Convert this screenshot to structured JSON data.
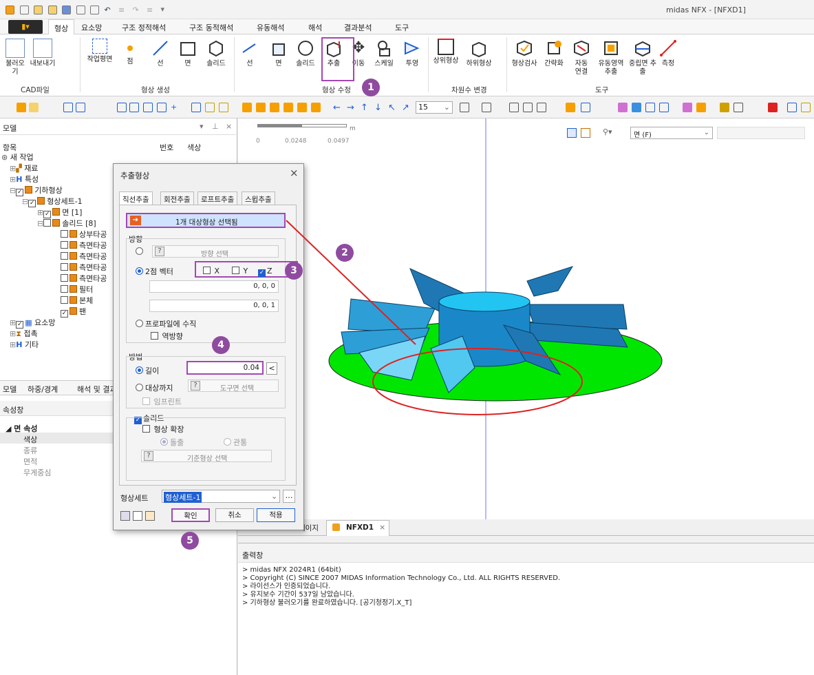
{
  "window_title": "midas NFX - [NFXD1]",
  "menu": [
    "형상",
    "요소망",
    "구조 정적해석",
    "구조 동적해석",
    "유동해석",
    "해석",
    "결과분석",
    "도구"
  ],
  "ribbon": {
    "cad_group": "CAD파일",
    "import": "불러오기",
    "export": "내보내기",
    "create_group": "형상 생성",
    "work_plane": "작업평면",
    "point": "점",
    "line": "선",
    "face": "면",
    "solid": "솔리드",
    "modify_group": "형상 수정",
    "m_line": "선",
    "m_face": "면",
    "m_solid": "솔리드",
    "extrude": "추출",
    "move": "이동",
    "scale": "스케일",
    "project": "투영",
    "dim_group": "차원수 변경",
    "upper": "상위형상",
    "lower": "하위형상",
    "tool_group": "도구",
    "check": "형상검사",
    "simplify": "간략화",
    "auto_connect": "자동 연결",
    "fluid_extract": "유동영역 추출",
    "mid_extract": "중립면 추출",
    "measure": "측정"
  },
  "toolbar": {
    "angle_value": "15"
  },
  "model_panel": {
    "title": "모델",
    "col_item": "항목",
    "col_num": "번호",
    "col_color": "색상",
    "tree": [
      {
        "label": "새 작업",
        "indent": 0
      },
      {
        "label": "재료",
        "indent": 1
      },
      {
        "label": "특성",
        "indent": 1
      },
      {
        "label": "기하형상",
        "indent": 1
      },
      {
        "label": "형상세트-1",
        "indent": 2
      },
      {
        "label": "면 [1]",
        "indent": 3
      },
      {
        "label": "솔리드 [8]",
        "indent": 3
      },
      {
        "label": "상부타공",
        "indent": 4
      },
      {
        "label": "측면타공",
        "indent": 4
      },
      {
        "label": "측면타공",
        "indent": 4
      },
      {
        "label": "측면타공",
        "indent": 4
      },
      {
        "label": "측면타공",
        "indent": 4
      },
      {
        "label": "필터",
        "indent": 4
      },
      {
        "label": "본체",
        "indent": 4
      },
      {
        "label": "팬",
        "indent": 4
      },
      {
        "label": "요소망",
        "indent": 1
      },
      {
        "label": "접촉",
        "indent": 1
      },
      {
        "label": "기타",
        "indent": 1
      }
    ],
    "tabs": [
      "모델",
      "하중/경계",
      "해석 및 결과"
    ]
  },
  "properties": {
    "title": "속성창",
    "section": "면 속성",
    "rows": [
      "색상",
      "종류",
      "면적",
      "무게중심"
    ]
  },
  "viewport": {
    "scale_unit": "m",
    "scale_ticks": [
      "0",
      "0.0248",
      "0.0497"
    ],
    "filter_label": "면 (F)"
  },
  "dialog": {
    "title": "추출형상",
    "tabs": [
      "직선추출",
      "회전추출",
      "로프트추출",
      "스윕추출"
    ],
    "target_btn": "1개 대상형상 선택됨",
    "direction_label": "방향",
    "dir_select": "방향 선택",
    "two_point": "2점 벡터",
    "x": "X",
    "y": "Y",
    "z": "Z",
    "vec_from": "0, 0, 0",
    "vec_to": "0, 0, 1",
    "profile_normal": "프로파일에 수직",
    "reverse": "역방향",
    "method_label": "방법",
    "length": "길이",
    "length_value": "0.04",
    "to_target": "대상까지",
    "tool_face": "도구면 선택",
    "imprint": "임프린트",
    "solid": "솔리드",
    "extend": "형상 확장",
    "protrude": "돌출",
    "through": "관통",
    "ref_shape": "기준형상 선택",
    "set_label": "형상세트",
    "set_value": "형상세트-1",
    "ok": "확인",
    "cancel": "취소",
    "apply": "적용"
  },
  "doc_tabs": {
    "page": "페이지",
    "active": "NFXD1"
  },
  "output": {
    "title": "출력창",
    "lines": [
      "> midas NFX 2024R1 (64bit)",
      "> Copyright (C) SINCE 2007 MIDAS Information Technology Co., Ltd. ALL RIGHTS RESERVED.",
      "> 라이선스가 인증되었습니다.",
      "> 유지보수 기간이 537일 남았습니다.",
      "> 기하형상 불러오기를 완료하였습니다. [공기청정기.X_T]"
    ]
  },
  "steps": [
    "1",
    "2",
    "3",
    "4",
    "5"
  ],
  "colors": {
    "accent": "#8f4b9f",
    "ground": "#00e600",
    "fan": "#2d9fd6",
    "annotation_red": "#d22"
  }
}
